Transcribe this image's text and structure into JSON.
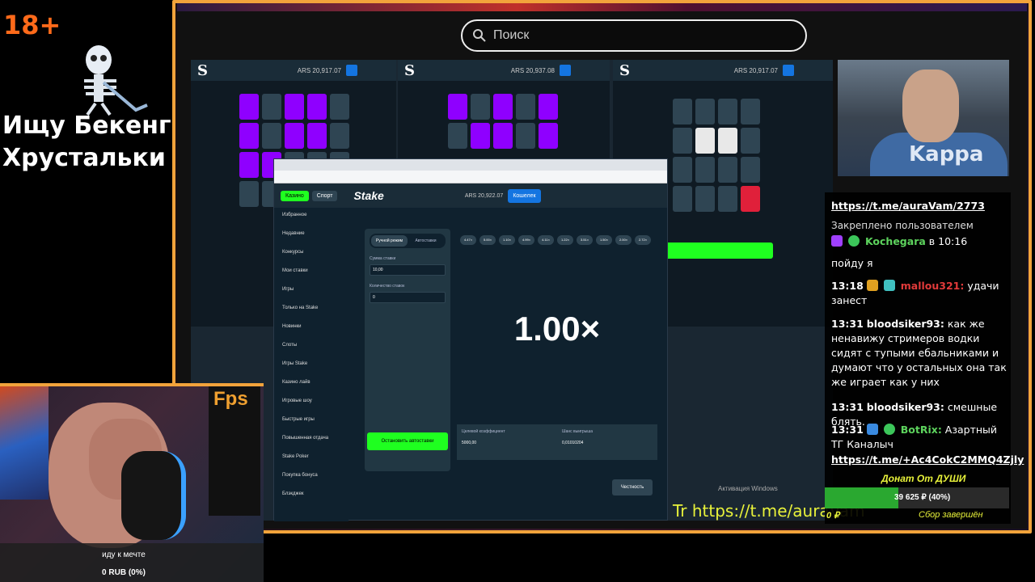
{
  "overlay": {
    "age_rating": "18+",
    "title_line1": "Ищу Бекенг",
    "title_line2": "Хрустальки"
  },
  "search": {
    "placeholder": "Поиск"
  },
  "capture": {
    "panel1_balance": "ARS 20,917.07",
    "panel2_balance": "ARS 20,937.08",
    "panel3_balance": "ARS 20,917.07",
    "stake_logo": "Stake",
    "stake_balance": "ARS 20,922.07",
    "wallet_label": "Кошелек",
    "casino_tab": "Казино",
    "sport_tab": "Спорт",
    "manual_tab": "Ручной режим",
    "auto_tab": "Автоставки",
    "bet_amount_label": "Сумма ставки",
    "bet_amount_value": "10,00",
    "bet_count_label": "Количество ставок",
    "bet_count_value": "0",
    "stop_button": "Остановить автоставки",
    "multiplier": "1.00×",
    "target_label": "Целевой коэффициент",
    "target_value": "5000,00",
    "win_chance_label": "Шанс выигрыша",
    "win_chance_value": "0,01010204",
    "fairness": "Честность",
    "chips": [
      "4.47×",
      "5.00×",
      "1.10×",
      "4.99×",
      "4.11×",
      "1.22×",
      "3.51×",
      "1.50×",
      "2.00×",
      "2.72×"
    ],
    "sidebar_items": [
      "Избранное",
      "Недавние",
      "Конкурсы",
      "Мои ставки",
      "Игры",
      "Только на Stake",
      "Новинки",
      "Слоты",
      "Игры Stake",
      "Казино лайв",
      "Игровые шоу",
      "Быстрые игры",
      "Повышенная отдача",
      "Stake Poker",
      "Покупка бонуса",
      "Блэкджек"
    ]
  },
  "stream": {
    "telegram_link": "Tr https://t.me/auraVam",
    "windows_activation": "Активация Windows"
  },
  "chat": {
    "pinned_link": "https://t.me/auraVam/2773",
    "pinned_by": "Закреплено пользователем",
    "pinned_user": "Kochegara",
    "pinned_time": "в 10:16",
    "msg0_text": "пойду я",
    "msg1_time": "13:18",
    "msg1_user": "mallou321:",
    "msg1_text": "удачи занест",
    "msg2_time": "13:31",
    "msg2_user": "bloodsiker93:",
    "msg2_text": "как же ненавижу стримеров водки сидят с тупыми ебальниками и думают что у остальных она так же играет как у них",
    "msg3_time": "13:31",
    "msg3_user": "bloodsiker93:",
    "msg3_text": "смешные блять.",
    "msg4_time": "13:31",
    "msg4_user": "BotRix:",
    "msg4_text": "Азартный ТГ Каналыч",
    "msg4_link": "https://t.me/+Ac4CokC2MMQ4Zjly"
  },
  "goal": {
    "title": "Донат От ДУШИ",
    "progress_text": "39 625 ₽ (40%)",
    "progress_fraction": 0.4,
    "left_value": "0 ₽",
    "status": "Сбор завершён"
  },
  "webcam_left": {
    "fps_label": "Fps",
    "caption": "иду к мечте",
    "amount": "0 RUB (0%)"
  },
  "colors": {
    "frame": "#f2a33b",
    "accent_green": "#1fff20",
    "purple_tile": "#8f00ff",
    "link_yellow": "#e8f23a"
  }
}
